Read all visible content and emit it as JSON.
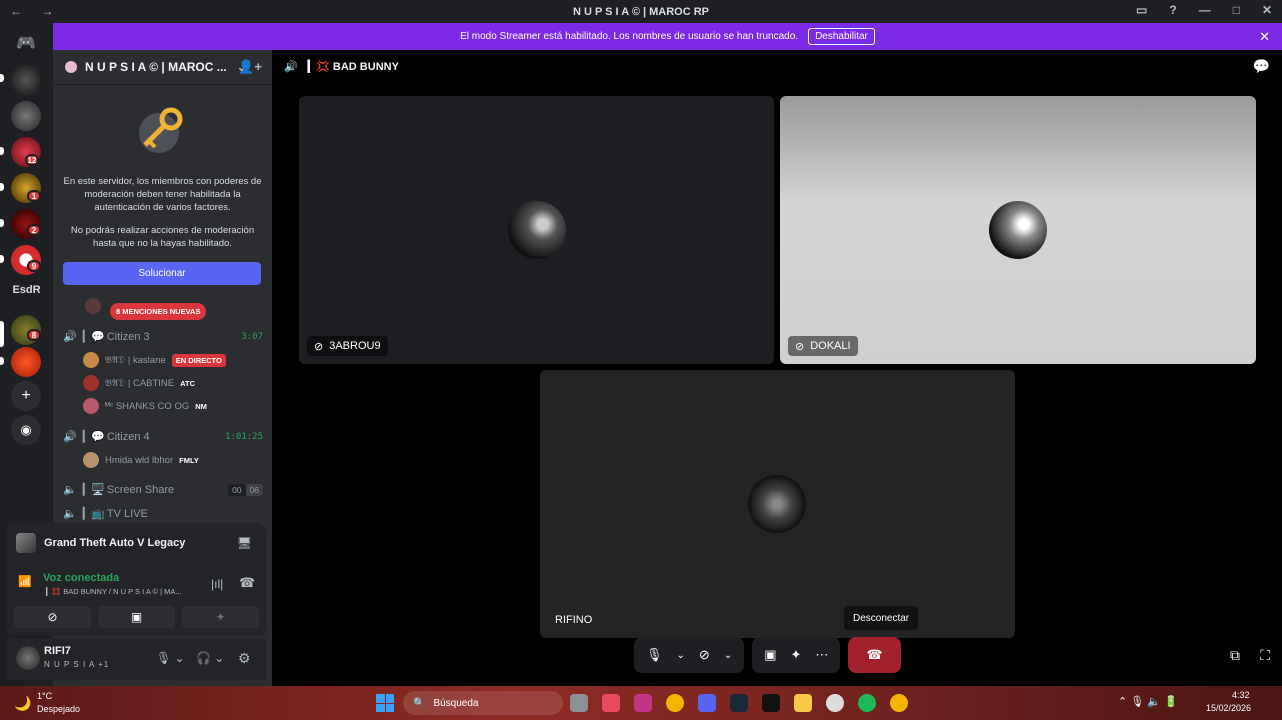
{
  "window": {
    "title": "N U P S I A ©  | MAROC RP"
  },
  "banner": {
    "text": "El modo Streamer está habilitado. Los nombres de usuario se han truncado.",
    "button": "Deshabilitar"
  },
  "rail": {
    "label": "EsdR",
    "badges": [
      "12",
      "1",
      "2",
      "9",
      "8"
    ]
  },
  "server": {
    "name": "N U P S I A ©  | MAROC ..."
  },
  "mfa": {
    "text1": "En este servidor, los miembros con poderes de moderación deben tener habilitada la autenticación de varios factores.",
    "text2": "No podrás realizar acciones de moderación hasta que no la hayas habilitado.",
    "button": "Solucionar"
  },
  "mentions": "8 MENCIONES NUEVAS",
  "channels": [
    {
      "name": "Citizen 3",
      "prefix": "▎💬",
      "timer": "3:07"
    },
    {
      "name": "Citizen 4",
      "prefix": "▎💬",
      "timer": "1:01:25"
    },
    {
      "name": "Screen Share",
      "prefix": "▎🖥️",
      "counts": [
        "00",
        "06"
      ]
    },
    {
      "name": "TV LIVE",
      "prefix": "▎📺"
    }
  ],
  "users": [
    {
      "name": "𝔅𝔄𝔇 | kaslane",
      "tag": "EN DIRECTO"
    },
    {
      "name": "𝔅𝔄𝔇 | CABTINE",
      "tag": "ATC"
    },
    {
      "name": "ᴹᶜ SHANKS CO OG",
      "tag": "NM"
    },
    {
      "name": "Hmida wld lbhor",
      "tag": "FMLY"
    }
  ],
  "activity": {
    "title": "Grand Theft Auto V Legacy"
  },
  "voice": {
    "status": "Voz conectada",
    "channel": "▎💢 BAD BUNNY / N U P S I A ©  | MA..."
  },
  "me": {
    "name": "RIFI7",
    "sub": "N U P S I A +1"
  },
  "call": {
    "channel": "▎💢 BAD BUNNY",
    "tiles": [
      "3ABROU9",
      "DOKALI",
      "RIFINO"
    ],
    "tooltip": "Desconectar"
  },
  "taskbar": {
    "weather_temp": "1°C",
    "weather_text": "Despejado",
    "search": "Búsqueda",
    "time": "4:32",
    "date": "15/02/2026"
  },
  "colors": {
    "accent": "#5865f2",
    "streamer": "#7b2ae6",
    "danger": "#da373c",
    "green": "#23a55a"
  }
}
